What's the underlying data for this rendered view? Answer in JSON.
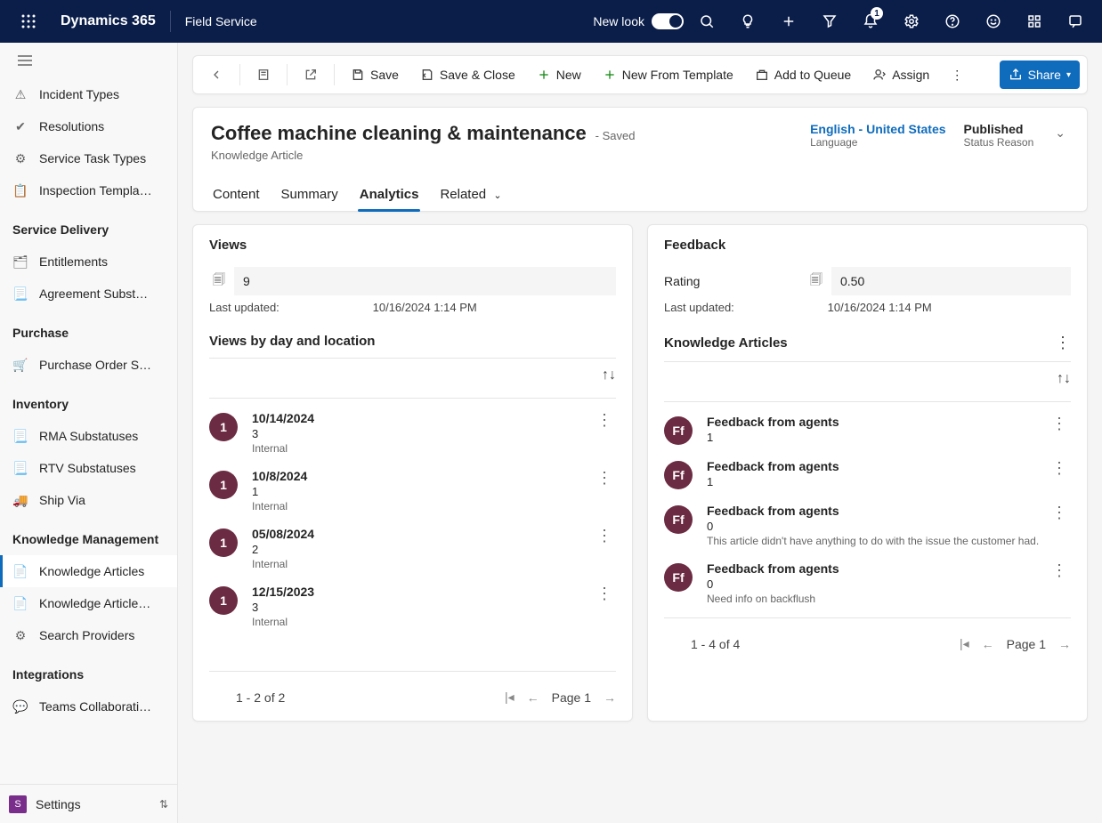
{
  "topbar": {
    "brand": "Dynamics 365",
    "app": "Field Service",
    "newLookLabel": "New look",
    "notifBadge": "1"
  },
  "sidebar": {
    "groups": [
      {
        "title": null,
        "items": [
          {
            "icon": "⚠",
            "label": "Incident Types"
          },
          {
            "icon": "✔",
            "label": "Resolutions"
          },
          {
            "icon": "⚙",
            "label": "Service Task Types"
          },
          {
            "icon": "📋",
            "label": "Inspection Templa…"
          }
        ]
      },
      {
        "title": "Service Delivery",
        "items": [
          {
            "icon": "🗂",
            "label": "Entitlements"
          },
          {
            "icon": "📃",
            "label": "Agreement Subst…"
          }
        ]
      },
      {
        "title": "Purchase",
        "items": [
          {
            "icon": "🛒",
            "label": "Purchase Order S…"
          }
        ]
      },
      {
        "title": "Inventory",
        "items": [
          {
            "icon": "📃",
            "label": "RMA Substatuses"
          },
          {
            "icon": "📃",
            "label": "RTV Substatuses"
          },
          {
            "icon": "🚚",
            "label": "Ship Via"
          }
        ]
      },
      {
        "title": "Knowledge Management",
        "items": [
          {
            "icon": "📄",
            "label": "Knowledge Articles",
            "selected": true
          },
          {
            "icon": "📄",
            "label": "Knowledge Article…"
          },
          {
            "icon": "⚙",
            "label": "Search Providers"
          }
        ]
      },
      {
        "title": "Integrations",
        "items": [
          {
            "icon": "💬",
            "label": "Teams Collaborati…"
          }
        ]
      }
    ],
    "area": {
      "initial": "S",
      "label": "Settings"
    }
  },
  "cmdbar": {
    "save": "Save",
    "saveClose": "Save & Close",
    "new": "New",
    "newFrom": "New From Template",
    "addQueue": "Add to Queue",
    "assign": "Assign",
    "share": "Share"
  },
  "header": {
    "title": "Coffee machine cleaning & maintenance",
    "savedLabel": "- Saved",
    "subtitle": "Knowledge Article",
    "language": {
      "value": "English - United States",
      "label": "Language"
    },
    "status": {
      "value": "Published",
      "label": "Status Reason"
    }
  },
  "tabs": [
    {
      "label": "Content"
    },
    {
      "label": "Summary"
    },
    {
      "label": "Analytics",
      "active": true
    },
    {
      "label": "Related",
      "dropdown": true
    }
  ],
  "views": {
    "title": "Views",
    "count": "9",
    "updatedLabel": "Last updated:",
    "updatedValue": "10/16/2024 1:14 PM",
    "listTitle": "Views by day and location",
    "items": [
      {
        "n": "1",
        "date": "10/14/2024",
        "count": "3",
        "src": "Internal"
      },
      {
        "n": "1",
        "date": "10/8/2024",
        "count": "1",
        "src": "Internal"
      },
      {
        "n": "1",
        "date": "05/08/2024",
        "count": "2",
        "src": "Internal"
      },
      {
        "n": "1",
        "date": "12/15/2023",
        "count": "3",
        "src": "Internal"
      }
    ],
    "pager": {
      "info": "1 - 2 of 2",
      "page": "Page 1"
    }
  },
  "feedback": {
    "title": "Feedback",
    "ratingLabel": "Rating",
    "ratingValue": "0.50",
    "updatedLabel": "Last updated:",
    "updatedValue": "10/16/2024 1:14 PM",
    "listTitle": "Knowledge Articles",
    "items": [
      {
        "init": "Ff",
        "title": "Feedback from agents",
        "score": "1",
        "note": ""
      },
      {
        "init": "Ff",
        "title": "Feedback from agents",
        "score": "1",
        "note": ""
      },
      {
        "init": "Ff",
        "title": "Feedback from agents",
        "score": "0",
        "note": "This article didn't have anything to do with the issue the customer had."
      },
      {
        "init": "Ff",
        "title": "Feedback from agents",
        "score": "0",
        "note": "Need info on backflush"
      }
    ],
    "pager": {
      "info": "1 - 4 of 4",
      "page": "Page 1"
    }
  }
}
